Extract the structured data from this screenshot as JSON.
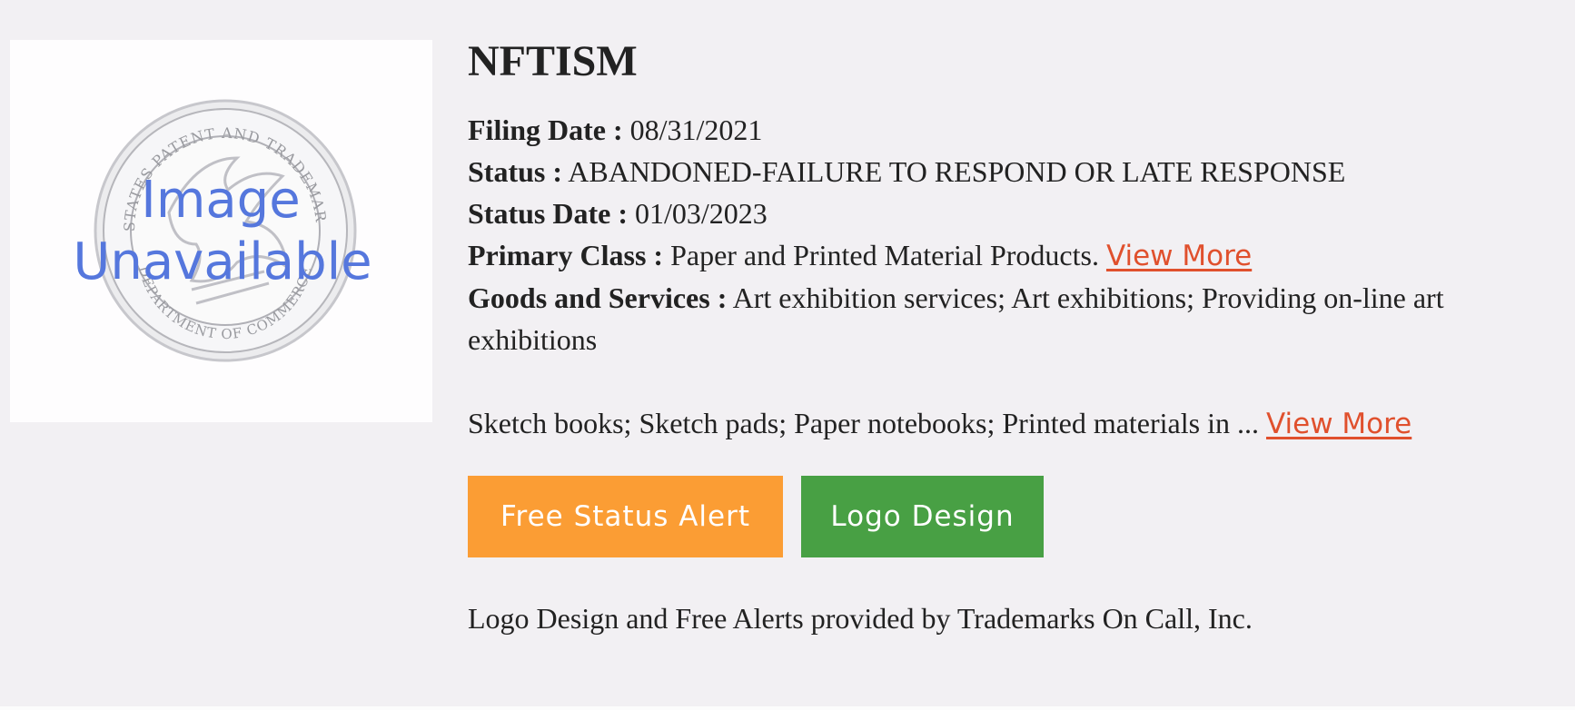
{
  "image": {
    "placeholder_line1": "Image",
    "placeholder_line2": "Unavailable",
    "seal_text_top": "UNITED STATES PATENT AND TRADEMARK OFFICE",
    "seal_text_bottom": "DEPARTMENT OF COMMERCE",
    "icon": "uspto-seal-icon"
  },
  "trademark": {
    "name": "NFTISM",
    "fields": {
      "filing_date": {
        "label": "Filing Date :",
        "value": "08/31/2021"
      },
      "status": {
        "label": "Status :",
        "value": "ABANDONED-FAILURE TO RESPOND OR LATE RESPONSE"
      },
      "status_date": {
        "label": "Status Date :",
        "value": "01/03/2023"
      },
      "primary_class": {
        "label": "Primary Class :",
        "value": "Paper and Printed Material Products.",
        "link": "View More"
      },
      "goods_services": {
        "label": "Goods and Services :",
        "value": "Art exhibition services; Art exhibitions; Providing on-line art exhibitions"
      }
    },
    "sketch_text": "Sketch books; Sketch pads; Paper notebooks; Printed materials in ...",
    "sketch_link": "View More"
  },
  "buttons": {
    "free_status_alert": "Free Status Alert",
    "logo_design": "Logo Design"
  },
  "footer_note": "Logo Design and Free Alerts provided by Trademarks On Call, Inc.",
  "colors": {
    "background": "#f2f0f3",
    "link": "#e0502d",
    "alert_button": "#fb9d34",
    "logo_button": "#48a044",
    "placeholder_text": "#5577dd"
  }
}
